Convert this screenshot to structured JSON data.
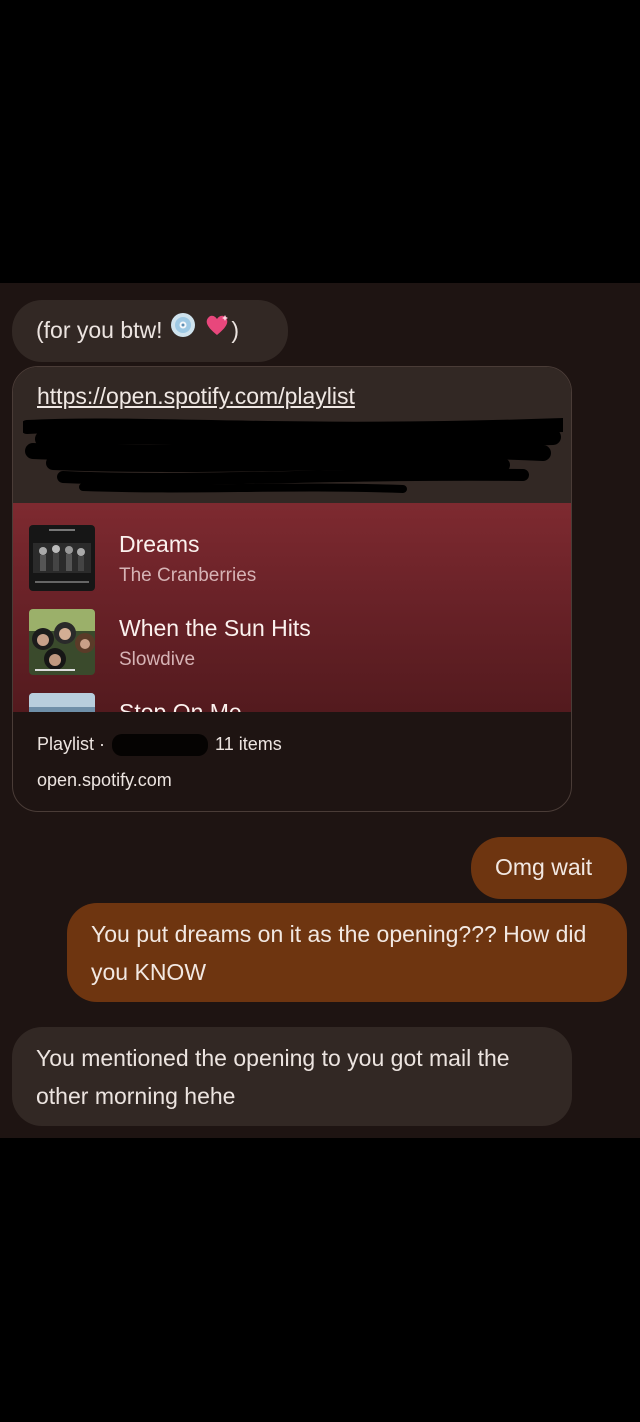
{
  "messages": {
    "first": {
      "text": "(for you btw!",
      "emoji": [
        "disc-emoji",
        "heart-emoji"
      ],
      "close": ")"
    },
    "link_card": {
      "url": "https://open.spotify.com/playlist",
      "tracks": [
        {
          "title": "Dreams",
          "artist": "The Cranberries"
        },
        {
          "title": "When the Sun Hits",
          "artist": "Slowdive"
        },
        {
          "title": "Stop On Me",
          "artist": ""
        }
      ],
      "meta_prefix": "Playlist ·",
      "meta_suffix": "11 items",
      "domain": "open.spotify.com"
    },
    "sent": [
      "Omg wait",
      "You put dreams on it as the opening??? How did you KNOW"
    ],
    "reply": "You mentioned the opening to you got mail the other morning hehe"
  },
  "colors": {
    "background": "#000000",
    "conversation": "#1e1412",
    "incoming_bubble": "#322824",
    "outgoing_bubble": "#6e3510",
    "preview_red": "#7e2a30"
  }
}
